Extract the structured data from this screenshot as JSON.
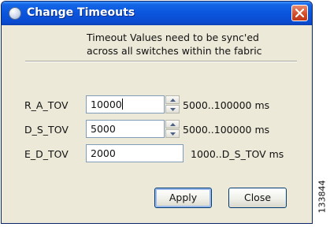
{
  "window": {
    "title": "Change Timeouts",
    "icon": "app-icon",
    "close_icon": "close-icon"
  },
  "message": {
    "line1": "Timeout Values need to be sync'ed",
    "line2": "across all switches within the fabric"
  },
  "fields": [
    {
      "label": "R_A_TOV",
      "value": "10000",
      "range": "5000..100000 ms",
      "has_spinner": true,
      "focused": true
    },
    {
      "label": "D_S_TOV",
      "value": "5000",
      "range": "5000..100000 ms",
      "has_spinner": true,
      "focused": false
    },
    {
      "label": "E_D_TOV",
      "value": "2000",
      "range": "1000..D_S_TOV ms",
      "has_spinner": false,
      "focused": false
    }
  ],
  "buttons": {
    "apply": "Apply",
    "close": "Close"
  },
  "figure_id": "133844",
  "colors": {
    "titlebar": "#0a55dd",
    "close_button": "#d24a26",
    "dialog_bg": "#ece9d8",
    "field_border": "#7f9db9"
  }
}
